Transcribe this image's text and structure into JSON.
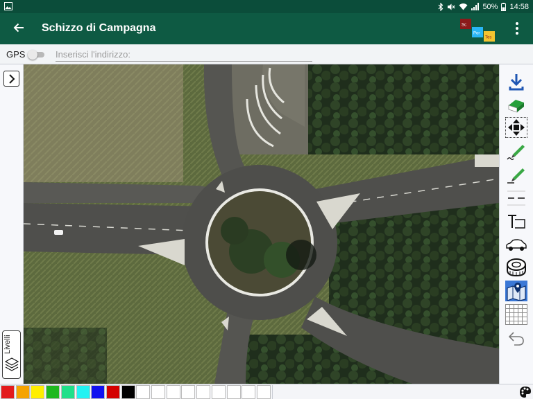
{
  "status_bar": {
    "battery_text": "50%",
    "time": "14:58",
    "left_icon": "image-notification-icon",
    "right_icons": [
      "bluetooth-icon",
      "mute-icon",
      "wifi-icon",
      "signal-icon",
      "battery-icon"
    ]
  },
  "app_bar": {
    "title": "Schizzo di Campagna",
    "back_icon": "arrow-back-icon",
    "menu_icon": "more-vertical-icon",
    "logo": {
      "tiles": [
        {
          "text": "Sc",
          "color": "#8b1a1a"
        },
        {
          "text": "Por",
          "color": "#29b6f6"
        },
        {
          "text": "Tes",
          "color": "#f4c430"
        }
      ]
    }
  },
  "gps_bar": {
    "gps_label": "GPS",
    "gps_enabled": false,
    "address_placeholder": "Inserisci l'indirizzo:",
    "address_value": ""
  },
  "left_panel": {
    "expand_icon": "chevron-right-icon",
    "layers_label": "Livelli",
    "layers_icon": "layers-icon"
  },
  "toolbar": {
    "tools": [
      {
        "name": "download-icon"
      },
      {
        "name": "eraser-icon"
      },
      {
        "name": "move-arrows-icon"
      },
      {
        "name": "freehand-pencil-icon"
      },
      {
        "name": "line-pencil-icon"
      },
      {
        "name": "dashed-line-icon"
      },
      {
        "name": "text-tool-icon"
      },
      {
        "name": "car-icon"
      },
      {
        "name": "measuring-tape-icon"
      },
      {
        "name": "map-layer-icon",
        "selected": true
      },
      {
        "name": "grid-icon"
      },
      {
        "name": "undo-icon"
      }
    ]
  },
  "palette": {
    "colors": [
      "#e31a1c",
      "#f5a300",
      "#ffee00",
      "#1fb81f",
      "#1fe08a",
      "#22f2f2",
      "#1010f0",
      "#d40000",
      "#000000",
      "#ffffff",
      "#ffffff",
      "#ffffff",
      "#ffffff",
      "#ffffff",
      "#ffffff",
      "#ffffff",
      "#ffffff",
      "#ffffff"
    ],
    "palette_icon": "palette-icon"
  },
  "colors": {
    "app_bar": "#0e5a43",
    "status_bar": "#0b4d3a",
    "accent": "#3b78d6"
  }
}
